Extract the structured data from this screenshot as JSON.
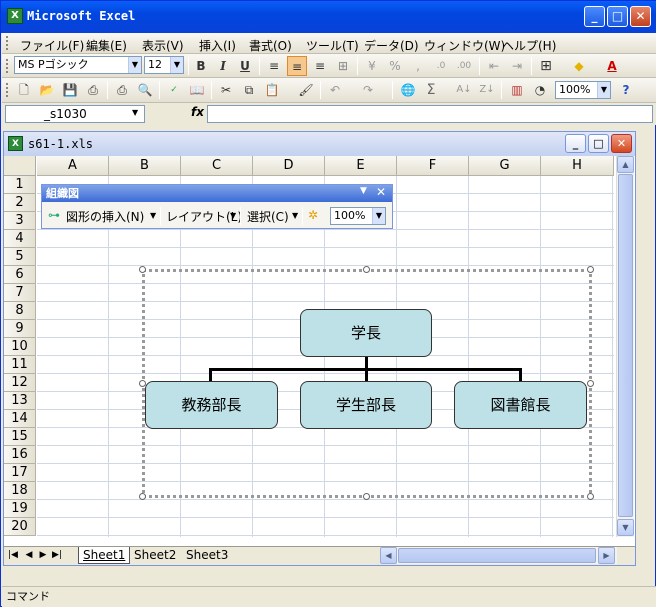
{
  "app": {
    "title": "Microsoft Excel",
    "icon": "X"
  },
  "menu": [
    "ファイル(F)",
    "編集(E)",
    "表示(V)",
    "挿入(I)",
    "書式(O)",
    "ツール(T)",
    "データ(D)",
    "ウィンドウ(W)",
    "ヘルプ(H)"
  ],
  "format_toolbar": {
    "font": "MS Pゴシック",
    "size": "12",
    "bold": "B",
    "italic": "I",
    "underline": "U",
    "percent": "%",
    "comma": ","
  },
  "std_toolbar": {
    "zoom": "100%",
    "sigma": "Σ"
  },
  "formula_bar": {
    "name_box": "_s1030",
    "fx": "fx",
    "value": ""
  },
  "workbook": {
    "title": "s61-1.xls"
  },
  "columns": [
    "A",
    "B",
    "C",
    "D",
    "E",
    "F",
    "G",
    "H"
  ],
  "rows": [
    "1",
    "2",
    "3",
    "4",
    "5",
    "6",
    "7",
    "8",
    "9",
    "10",
    "11",
    "12",
    "13",
    "14",
    "15",
    "16",
    "17",
    "18",
    "19",
    "20"
  ],
  "org_toolbar": {
    "title": "組織図",
    "insert_shape": "図形の挿入(N)",
    "layout": "レイアウト(L)",
    "select": "選択(C)",
    "zoom": "100%"
  },
  "org_chart": {
    "root": "学長",
    "children": [
      "教務部長",
      "学生部長",
      "図書館長"
    ],
    "fill": "#bde1e6"
  },
  "sheets": [
    "Sheet1",
    "Sheet2",
    "Sheet3"
  ],
  "status": "コマンド"
}
